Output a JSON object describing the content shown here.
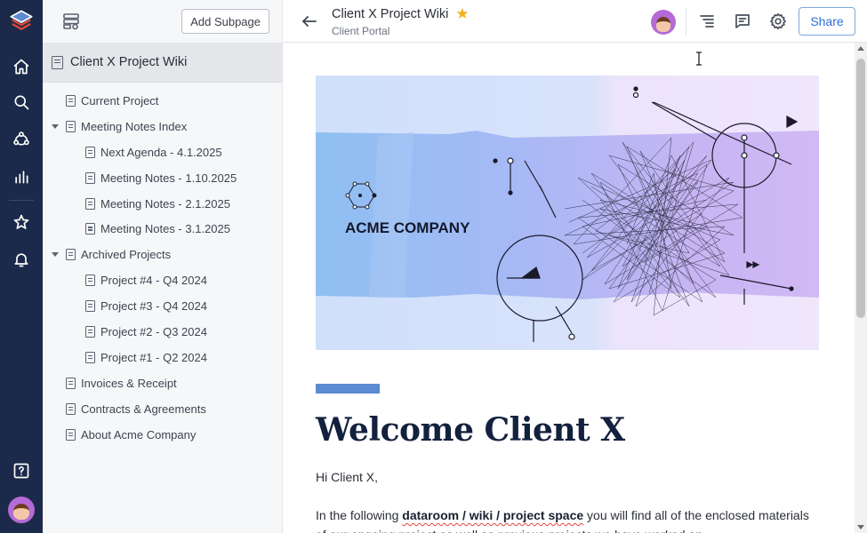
{
  "sidebar": {
    "add_subpage_label": "Add Subpage",
    "root_title": "Client X Project Wiki",
    "items": [
      {
        "label": "Current Project",
        "level": 1,
        "expandable": false
      },
      {
        "label": "Meeting Notes Index",
        "level": 1,
        "expandable": true
      },
      {
        "label": "Next Agenda - 4.1.2025",
        "level": 2,
        "expandable": false
      },
      {
        "label": "Meeting Notes - 1.10.2025",
        "level": 2,
        "expandable": false
      },
      {
        "label": "Meeting Notes - 2.1.2025",
        "level": 2,
        "expandable": false
      },
      {
        "label": "Meeting Notes - 3.1.2025",
        "level": 2,
        "expandable": false
      },
      {
        "label": "Archived Projects",
        "level": 1,
        "expandable": true
      },
      {
        "label": "Project #4 - Q4 2024",
        "level": 2,
        "expandable": false
      },
      {
        "label": "Project #3 - Q4 2024",
        "level": 2,
        "expandable": false
      },
      {
        "label": "Project #2 - Q3 2024",
        "level": 2,
        "expandable": false
      },
      {
        "label": "Project #1 - Q2 2024",
        "level": 2,
        "expandable": false
      },
      {
        "label": "Invoices & Receipt",
        "level": 1,
        "expandable": false
      },
      {
        "label": "Contracts & Agreements",
        "level": 1,
        "expandable": false
      },
      {
        "label": "About Acme Company",
        "level": 1,
        "expandable": false
      }
    ]
  },
  "header": {
    "title": "Client X Project Wiki",
    "subtitle": "Client Portal",
    "share_label": "Share",
    "favorite": true
  },
  "content": {
    "banner_company": "ACME COMPANY",
    "heading": "Welcome Client X",
    "greeting": "Hi Client X,",
    "intro_before": "In the following ",
    "intro_bold": "dataroom / wiki / project space",
    "intro_after": " you will find all of the enclosed materials of our ongoing project as well as previous projects we have worked on"
  },
  "colors": {
    "rail_bg": "#1b2a4a",
    "accent": "#2f6fd6",
    "star": "#f2b01e",
    "heading": "#13213e"
  },
  "icons": {
    "rail": [
      "logo-icon",
      "home-icon",
      "search-icon",
      "network-icon",
      "chart-icon",
      "star-icon",
      "bell-icon",
      "help-icon"
    ],
    "header": [
      "back-arrow-icon",
      "outline-icon",
      "comment-icon",
      "settings-icon"
    ]
  }
}
